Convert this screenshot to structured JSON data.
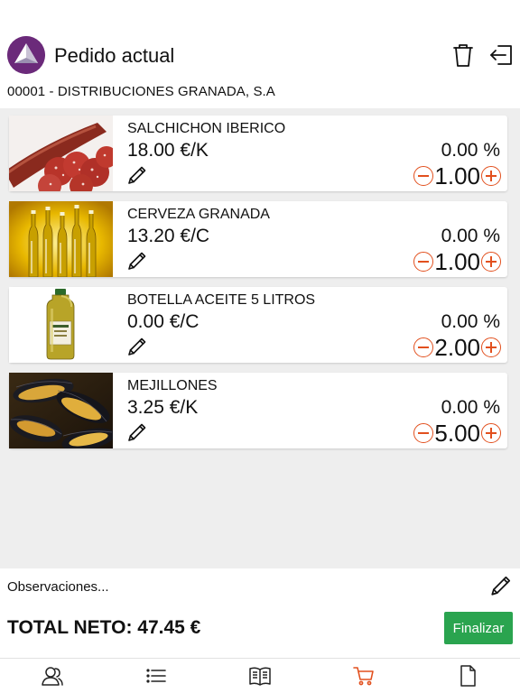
{
  "header": {
    "title": "Pedido actual",
    "customer": "00001 - DISTRIBUCIONES GRANADA, S.A",
    "actions": [
      "trash-icon",
      "logout-icon"
    ]
  },
  "products": [
    {
      "name": "SALCHICHON IBERICO",
      "price": "18.00 €/K",
      "discount": "0.00 %",
      "quantity": "1.00",
      "image": "salchichon-image"
    },
    {
      "name": "CERVEZA GRANADA",
      "price": "13.20 €/C",
      "discount": "0.00 %",
      "quantity": "1.00",
      "image": "beer-bottles-image"
    },
    {
      "name": "BOTELLA ACEITE 5 LITROS",
      "price": "0.00 €/C",
      "discount": "0.00 %",
      "quantity": "2.00",
      "image": "oil-bottle-image"
    },
    {
      "name": "MEJILLONES",
      "price": "3.25 €/K",
      "discount": "0.00 %",
      "quantity": "5.00",
      "image": "mussels-image"
    }
  ],
  "observations": {
    "placeholder": "Observaciones..."
  },
  "footer": {
    "total": "TOTAL NETO: 47.45 €",
    "finish_label": "Finalizar"
  },
  "tabs": [
    {
      "icon": "customers-icon",
      "active": false
    },
    {
      "icon": "list-icon",
      "active": false
    },
    {
      "icon": "catalog-icon",
      "active": false
    },
    {
      "icon": "cart-icon",
      "active": true
    },
    {
      "icon": "document-icon",
      "active": false
    }
  ],
  "colors": {
    "accent": "#e2501e",
    "finish_button": "#2aa44f",
    "logo": "#6b2a7a",
    "list_background": "#eeeeee"
  }
}
